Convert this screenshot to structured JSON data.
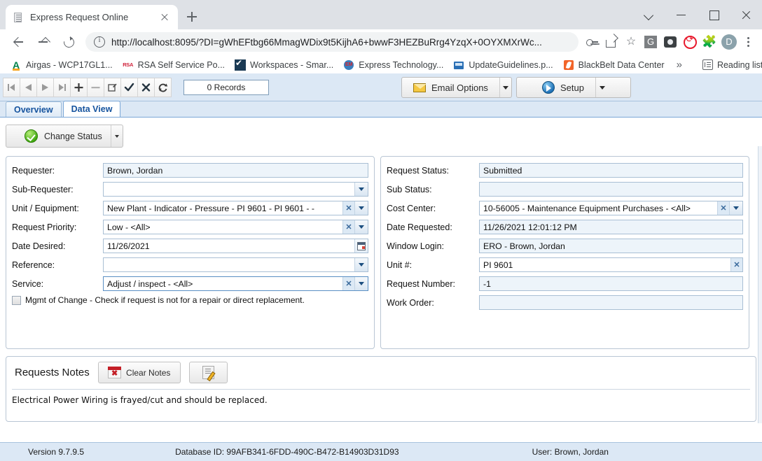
{
  "browser": {
    "tab": {
      "title": "Express Request Online",
      "favicon": "document-icon",
      "close": "×"
    },
    "new_tab": "+",
    "window_controls": {
      "chevron": "⌄",
      "minimize": "—",
      "maximize": "□",
      "close": "✕"
    },
    "url": "http://localhost:8095/?DI=gWhEFtbg66MmagWDix9t5KijhA6+bwwF3HEZBuRrg4YzqX+0OYXMXrWc...",
    "url_scheme": "http://",
    "url_rest": "localhost:8095/?DI=gWhEFtbg66MmagWDix9t5KijhA6+bwwF3HEZBuRrg4YzqX+0OYXMXrWc...",
    "omnibox_icons": [
      "key-icon",
      "share-icon",
      "star-icon"
    ],
    "extension_icons": [
      "grammarly-icon",
      "screencast-icon",
      "adblock-icon",
      "puzzle-icon"
    ],
    "profile_initial": "D",
    "menu": "kebab-menu-icon",
    "bookmarks": [
      {
        "label": "Airgas - WCP17GL1...",
        "icon": "airgas-icon"
      },
      {
        "label": "RSA Self Service Po...",
        "icon": "rsa-icon"
      },
      {
        "label": "Workspaces - Smar...",
        "icon": "workspaces-icon"
      },
      {
        "label": "Express Technology...",
        "icon": "express-technology-icon"
      },
      {
        "label": "UpdateGuidelines.p...",
        "icon": "pdf-icon"
      },
      {
        "label": "BlackBelt Data Center",
        "icon": "blackbelt-icon"
      }
    ],
    "bookmarks_overflow": "»",
    "reading_list": "Reading list"
  },
  "app": {
    "record_nav": [
      {
        "name": "first-record",
        "glyph": "|◀"
      },
      {
        "name": "previous-record",
        "glyph": "◀"
      },
      {
        "name": "next-record",
        "glyph": "▶"
      },
      {
        "name": "last-record",
        "glyph": "▶|"
      },
      {
        "name": "add-record",
        "glyph": "+"
      },
      {
        "name": "delete-record",
        "glyph": "−"
      },
      {
        "name": "edit-record",
        "glyph": "✎"
      },
      {
        "name": "accept-record",
        "glyph": "✔"
      },
      {
        "name": "cancel-record",
        "glyph": "✖"
      },
      {
        "name": "refresh-record",
        "glyph": "⟳"
      }
    ],
    "record_count": "0 Records",
    "email_options": "Email Options",
    "setup": "Setup",
    "tabs": [
      {
        "label": "Overview",
        "active": false
      },
      {
        "label": "Data View",
        "active": true
      }
    ],
    "change_status": "Change Status",
    "left_form": [
      {
        "label": "Requester:",
        "value": "Brown, Jordan",
        "type": "readonly"
      },
      {
        "label": "Sub-Requester:",
        "value": "",
        "type": "dropdown"
      },
      {
        "label": "Unit / Equipment:",
        "value": "New Plant - Indicator - Pressure - PI 9601 - PI 9601 -  -",
        "type": "dropdown-clear"
      },
      {
        "label": "Request Priority:",
        "value": "Low - <All>",
        "type": "dropdown-clear"
      },
      {
        "label": "Date Desired:",
        "value": "11/26/2021",
        "type": "date"
      },
      {
        "label": "Reference:",
        "value": "",
        "type": "dropdown"
      },
      {
        "label": "Service:",
        "value": "Adjust / inspect - <All>",
        "type": "dropdown-clear-focus"
      }
    ],
    "moc_checkbox": {
      "checked": false,
      "label": "Mgmt of Change - Check if request is not for a repair or direct replacement."
    },
    "right_form": [
      {
        "label": "Request Status:",
        "value": "Submitted",
        "type": "readonly"
      },
      {
        "label": "Sub Status:",
        "value": "",
        "type": "readonly"
      },
      {
        "label": "Cost Center:",
        "value": "10-56005 - Maintenance Equipment Purchases - <All>",
        "type": "dropdown-clear"
      },
      {
        "label": "Date Requested:",
        "value": "11/26/2021 12:01:12 PM",
        "type": "readonly"
      },
      {
        "label": "Window Login:",
        "value": "ERO - Brown, Jordan",
        "type": "readonly"
      },
      {
        "label": "Unit #:",
        "value": "PI 9601",
        "type": "clear"
      },
      {
        "label": "Request Number:",
        "value": "-1",
        "type": "readonly"
      },
      {
        "label": "Work Order:",
        "value": "",
        "type": "readonly"
      }
    ],
    "notes": {
      "title": "Requests Notes",
      "clear_button": "Clear Notes",
      "edit_button": "edit-notes-icon",
      "body": "Electrical Power Wiring is frayed/cut and should be replaced."
    },
    "status_bar": {
      "version": "Version 9.7.9.5",
      "database_id": "Database ID: 99AFB341-6FDD-490C-B472-B14903D31D93",
      "user": "User: Brown, Jordan"
    }
  },
  "colors": {
    "app_chrome": "#dce8f5",
    "tab_active_text": "#15539e",
    "field_border": "#a9bfd4",
    "status_green": "#3da60e"
  }
}
